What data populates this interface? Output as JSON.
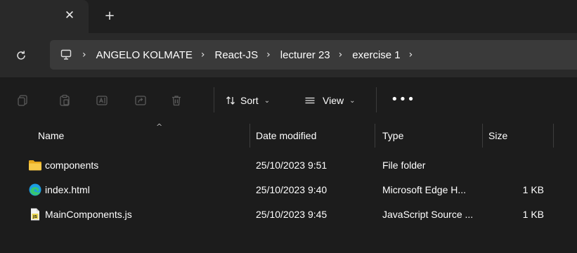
{
  "tabstrip": {
    "close_glyph": "✕",
    "new_tab_glyph": "+"
  },
  "address": {
    "refresh_icon": "refresh-icon",
    "root_icon": "computer-icon",
    "separator": "›",
    "crumbs": [
      "ANGELO KOLMATE",
      "React-JS",
      "lecturer 23",
      "exercise 1"
    ]
  },
  "toolbar": {
    "icons": [
      "new-icon",
      "paste-icon",
      "rename-icon",
      "share-icon",
      "delete-icon"
    ],
    "sort_label": "Sort",
    "view_label": "View",
    "more_label": "•••",
    "chevron": "⌄"
  },
  "columns": {
    "name": "Name",
    "date": "Date modified",
    "type": "Type",
    "size": "Size",
    "sort_caret": "^"
  },
  "files": [
    {
      "icon": "folder-icon",
      "name": "components",
      "date": "25/10/2023 9:51",
      "type": "File folder",
      "size": ""
    },
    {
      "icon": "edge-icon",
      "name": "index.html",
      "date": "25/10/2023 9:40",
      "type": "Microsoft Edge H...",
      "size": "1 KB"
    },
    {
      "icon": "js-file-icon",
      "name": "MainComponents.js",
      "date": "25/10/2023 9:45",
      "type": "JavaScript Source ...",
      "size": "1 KB"
    }
  ],
  "colors": {
    "folder": "#f2c037",
    "edge": "#1b9de2",
    "js": "#e8d44d"
  }
}
